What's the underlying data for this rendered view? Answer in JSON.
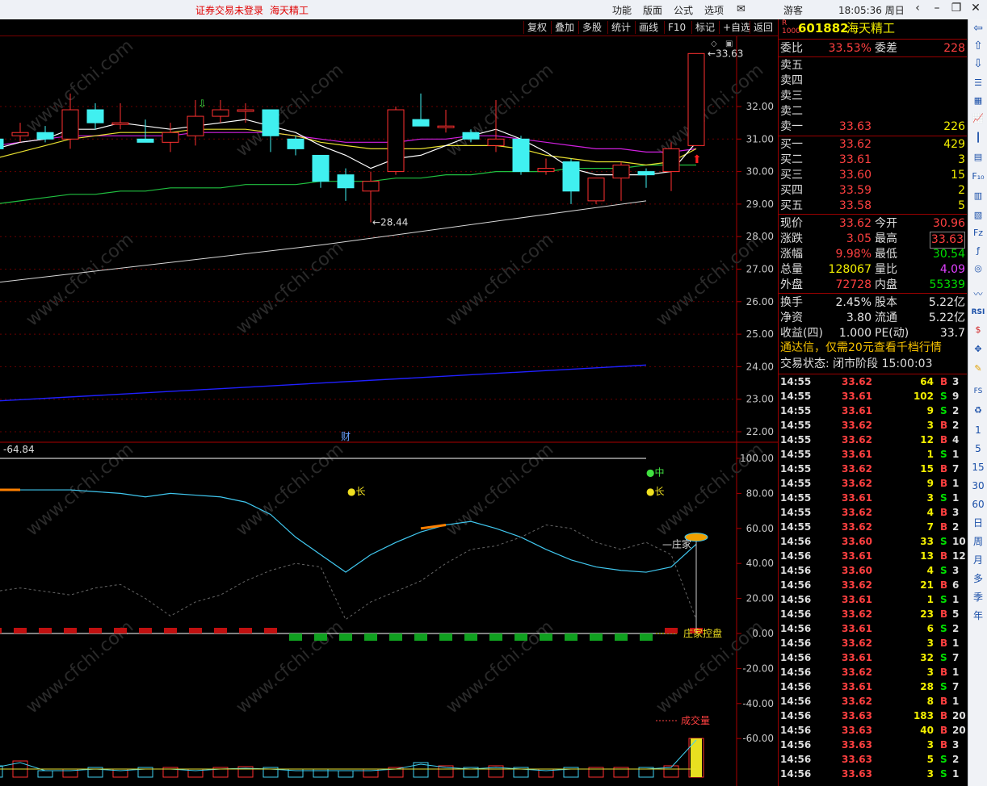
{
  "titlebar": {
    "login_status": "证券交易未登录",
    "stock_name": "海天精工",
    "menu": [
      "功能",
      "版面",
      "公式",
      "选项"
    ],
    "user": "游客",
    "clock": "18:05:36 周日"
  },
  "toolbar": [
    "复权",
    "叠加",
    "多股",
    "统计",
    "画线",
    "F10",
    "标记",
    "+自选",
    "返回"
  ],
  "main_chart": {
    "y_ticks": [
      "32.00",
      "31.00",
      "30.00",
      "29.00",
      "28.00",
      "27.00",
      "26.00",
      "25.00",
      "24.00",
      "23.00",
      "22.00"
    ],
    "high_label": "33.63",
    "low_label": "28.44",
    "fin_marker": "财",
    "watermark": "www.cfchi.com"
  },
  "chart_data": {
    "type": "candlestick",
    "price_range": [
      21.7,
      34.0
    ],
    "candles": [
      {
        "o": 31.0,
        "h": 31.4,
        "l": 30.6,
        "c": 30.7
      },
      {
        "o": 31.1,
        "h": 31.5,
        "l": 30.9,
        "c": 31.2
      },
      {
        "o": 31.2,
        "h": 31.4,
        "l": 30.9,
        "c": 31.0
      },
      {
        "o": 31.0,
        "h": 32.4,
        "l": 30.7,
        "c": 31.9
      },
      {
        "o": 31.9,
        "h": 32.1,
        "l": 31.3,
        "c": 31.5
      },
      {
        "o": 31.5,
        "h": 32.1,
        "l": 31.3,
        "c": 31.5
      },
      {
        "o": 31.0,
        "h": 31.6,
        "l": 30.9,
        "c": 30.9
      },
      {
        "o": 30.9,
        "h": 31.5,
        "l": 30.6,
        "c": 31.2
      },
      {
        "o": 31.1,
        "h": 32.2,
        "l": 30.8,
        "c": 31.7
      },
      {
        "o": 31.7,
        "h": 32.2,
        "l": 31.5,
        "c": 31.9
      },
      {
        "o": 31.9,
        "h": 32.1,
        "l": 31.5,
        "c": 31.9
      },
      {
        "o": 31.9,
        "h": 31.9,
        "l": 30.6,
        "c": 31.1
      },
      {
        "o": 31.0,
        "h": 31.1,
        "l": 30.5,
        "c": 30.7
      },
      {
        "o": 30.5,
        "h": 30.5,
        "l": 29.5,
        "c": 29.7
      },
      {
        "o": 29.9,
        "h": 30.1,
        "l": 29.1,
        "c": 29.5
      },
      {
        "o": 29.4,
        "h": 30.0,
        "l": 28.44,
        "c": 29.7
      },
      {
        "o": 30.0,
        "h": 32.0,
        "l": 29.9,
        "c": 31.9
      },
      {
        "o": 31.6,
        "h": 32.4,
        "l": 31.4,
        "c": 31.4
      },
      {
        "o": 31.4,
        "h": 31.9,
        "l": 31.2,
        "c": 31.4
      },
      {
        "o": 31.2,
        "h": 31.3,
        "l": 30.9,
        "c": 31.0
      },
      {
        "o": 30.8,
        "h": 32.2,
        "l": 30.6,
        "c": 31.0
      },
      {
        "o": 31.0,
        "h": 31.1,
        "l": 29.9,
        "c": 30.0
      },
      {
        "o": 30.0,
        "h": 30.4,
        "l": 29.9,
        "c": 30.1
      },
      {
        "o": 30.3,
        "h": 30.4,
        "l": 29.0,
        "c": 29.4
      },
      {
        "o": 29.1,
        "h": 29.8,
        "l": 29.0,
        "c": 29.8
      },
      {
        "o": 29.8,
        "h": 30.3,
        "l": 29.1,
        "c": 30.2
      },
      {
        "o": 30.0,
        "h": 30.1,
        "l": 29.5,
        "c": 29.9
      },
      {
        "o": 30.0,
        "h": 30.9,
        "l": 29.4,
        "c": 30.7
      },
      {
        "o": 30.8,
        "h": 33.63,
        "l": 30.8,
        "c": 33.63
      }
    ],
    "ma_white_short": [
      30.7,
      30.9,
      31.0,
      31.3,
      31.3,
      31.5,
      31.4,
      31.3,
      31.4,
      31.5,
      31.6,
      31.4,
      31.2,
      30.8,
      30.5,
      30.1,
      30.4,
      30.5,
      30.8,
      31.1,
      31.3,
      31.0,
      30.6,
      30.1,
      29.9,
      29.9,
      29.9,
      30.0,
      30.9
    ],
    "ma_yellow": [
      30.4,
      30.6,
      30.8,
      31.0,
      31.1,
      31.2,
      31.2,
      31.2,
      31.3,
      31.3,
      31.3,
      31.2,
      31.1,
      30.9,
      30.8,
      30.7,
      30.7,
      30.7,
      30.8,
      30.8,
      30.8,
      30.7,
      30.5,
      30.4,
      30.3,
      30.3,
      30.2,
      30.3,
      30.7
    ],
    "ma_magenta": [
      30.8,
      30.9,
      31.0,
      31.1,
      31.1,
      31.1,
      31.1,
      31.1,
      31.2,
      31.2,
      31.2,
      31.2,
      31.1,
      31.0,
      30.9,
      30.9,
      30.9,
      31.0,
      31.0,
      31.1,
      31.1,
      31.0,
      30.9,
      30.8,
      30.7,
      30.7,
      30.6,
      30.6,
      30.7
    ],
    "ma_green": [
      29.0,
      29.1,
      29.2,
      29.3,
      29.3,
      29.4,
      29.4,
      29.5,
      29.5,
      29.5,
      29.6,
      29.6,
      29.6,
      29.7,
      29.7,
      29.7,
      29.8,
      29.8,
      29.9,
      29.9,
      30.0,
      30.0,
      30.0,
      30.1,
      30.1,
      30.1,
      30.2,
      30.2,
      30.2
    ],
    "indicator_range": [
      -72,
      105
    ],
    "indicator_label": "-64.84",
    "indicator_line": [
      82,
      82,
      82,
      82,
      81,
      80,
      78,
      80,
      79,
      78,
      75,
      68,
      55,
      45,
      35,
      45,
      52,
      58,
      62,
      64,
      60,
      55,
      48,
      42,
      38,
      36,
      35,
      38,
      51
    ],
    "indicator_dotted": [
      24,
      26,
      24,
      22,
      26,
      28,
      20,
      10,
      18,
      22,
      30,
      36,
      40,
      38,
      8,
      18,
      24,
      30,
      40,
      48,
      50,
      55,
      62,
      60,
      52,
      48,
      52,
      45,
      8
    ],
    "tags": {
      "mid": "中",
      "long": "长",
      "zhuangjia": "庄家",
      "kongpan": "庄家控盘",
      "volume": "成交量"
    }
  },
  "quote": {
    "code": "601882",
    "name": "海天精工",
    "weibi_label": "委比",
    "weibi": "33.53%",
    "weicha_label": "委差",
    "weicha": "228",
    "sells": [
      {
        "label": "卖五",
        "price": "",
        "vol": ""
      },
      {
        "label": "卖四",
        "price": "",
        "vol": ""
      },
      {
        "label": "卖三",
        "price": "",
        "vol": ""
      },
      {
        "label": "卖二",
        "price": "",
        "vol": ""
      },
      {
        "label": "卖一",
        "price": "33.63",
        "vol": "226"
      }
    ],
    "buys": [
      {
        "label": "买一",
        "price": "33.62",
        "vol": "429"
      },
      {
        "label": "买二",
        "price": "33.61",
        "vol": "3"
      },
      {
        "label": "买三",
        "price": "33.60",
        "vol": "15"
      },
      {
        "label": "买四",
        "price": "33.59",
        "vol": "2"
      },
      {
        "label": "买五",
        "price": "33.58",
        "vol": "5"
      }
    ],
    "stats": [
      {
        "l1": "现价",
        "v1": "33.62",
        "c1": "red",
        "l2": "今开",
        "v2": "30.96",
        "c2": "red"
      },
      {
        "l1": "涨跌",
        "v1": "3.05",
        "c1": "red",
        "l2": "最高",
        "v2": "33.63",
        "c2": "red"
      },
      {
        "l1": "涨幅",
        "v1": "9.98%",
        "c1": "red",
        "l2": "最低",
        "v2": "30.54",
        "c2": "green"
      },
      {
        "l1": "总量",
        "v1": "128067",
        "c1": "yellow",
        "l2": "量比",
        "v2": "4.09",
        "c2": "mag"
      },
      {
        "l1": "外盘",
        "v1": "72728",
        "c1": "red",
        "l2": "内盘",
        "v2": "55339",
        "c2": "green"
      },
      {
        "l1": "换手",
        "v1": "2.45%",
        "c1": "white",
        "l2": "股本",
        "v2": "5.22亿",
        "c2": "white"
      },
      {
        "l1": "净资",
        "v1": "3.80",
        "c1": "white",
        "l2": "流通",
        "v2": "5.22亿",
        "c2": "white"
      },
      {
        "l1": "收益(四)",
        "v1": "1.000",
        "c1": "white",
        "l2": "PE(动)",
        "v2": "33.7",
        "c2": "white"
      }
    ],
    "promo": "通达信，仅需20元查看千档行情",
    "trade_status": "交易状态: 闭市阶段 15:00:03"
  },
  "ticks": [
    [
      "14:55",
      "33.62",
      "64",
      "B",
      "3"
    ],
    [
      "14:55",
      "33.61",
      "102",
      "S",
      "9"
    ],
    [
      "14:55",
      "33.61",
      "9",
      "S",
      "2"
    ],
    [
      "14:55",
      "33.62",
      "3",
      "B",
      "2"
    ],
    [
      "14:55",
      "33.62",
      "12",
      "B",
      "4"
    ],
    [
      "14:55",
      "33.61",
      "1",
      "S",
      "1"
    ],
    [
      "14:55",
      "33.62",
      "15",
      "B",
      "7"
    ],
    [
      "14:55",
      "33.62",
      "9",
      "B",
      "1"
    ],
    [
      "14:55",
      "33.61",
      "3",
      "S",
      "1"
    ],
    [
      "14:55",
      "33.62",
      "4",
      "B",
      "3"
    ],
    [
      "14:55",
      "33.62",
      "7",
      "B",
      "2"
    ],
    [
      "14:56",
      "33.60",
      "33",
      "S",
      "10"
    ],
    [
      "14:56",
      "33.61",
      "13",
      "B",
      "12"
    ],
    [
      "14:56",
      "33.60",
      "4",
      "S",
      "3"
    ],
    [
      "14:56",
      "33.62",
      "21",
      "B",
      "6"
    ],
    [
      "14:56",
      "33.61",
      "1",
      "S",
      "1"
    ],
    [
      "14:56",
      "33.62",
      "23",
      "B",
      "5"
    ],
    [
      "14:56",
      "33.61",
      "6",
      "S",
      "2"
    ],
    [
      "14:56",
      "33.62",
      "3",
      "B",
      "1"
    ],
    [
      "14:56",
      "33.61",
      "32",
      "S",
      "7"
    ],
    [
      "14:56",
      "33.62",
      "3",
      "B",
      "1"
    ],
    [
      "14:56",
      "33.61",
      "28",
      "S",
      "7"
    ],
    [
      "14:56",
      "33.62",
      "8",
      "B",
      "1"
    ],
    [
      "14:56",
      "33.63",
      "183",
      "B",
      "20"
    ],
    [
      "14:56",
      "33.63",
      "40",
      "B",
      "20"
    ],
    [
      "14:56",
      "33.63",
      "3",
      "B",
      "3"
    ],
    [
      "14:56",
      "33.63",
      "5",
      "S",
      "2"
    ],
    [
      "14:56",
      "33.63",
      "3",
      "S",
      "1"
    ]
  ],
  "side_icons": [
    "1",
    "5",
    "15",
    "30",
    "60",
    "日",
    "周",
    "月",
    "多",
    "季",
    "年"
  ]
}
